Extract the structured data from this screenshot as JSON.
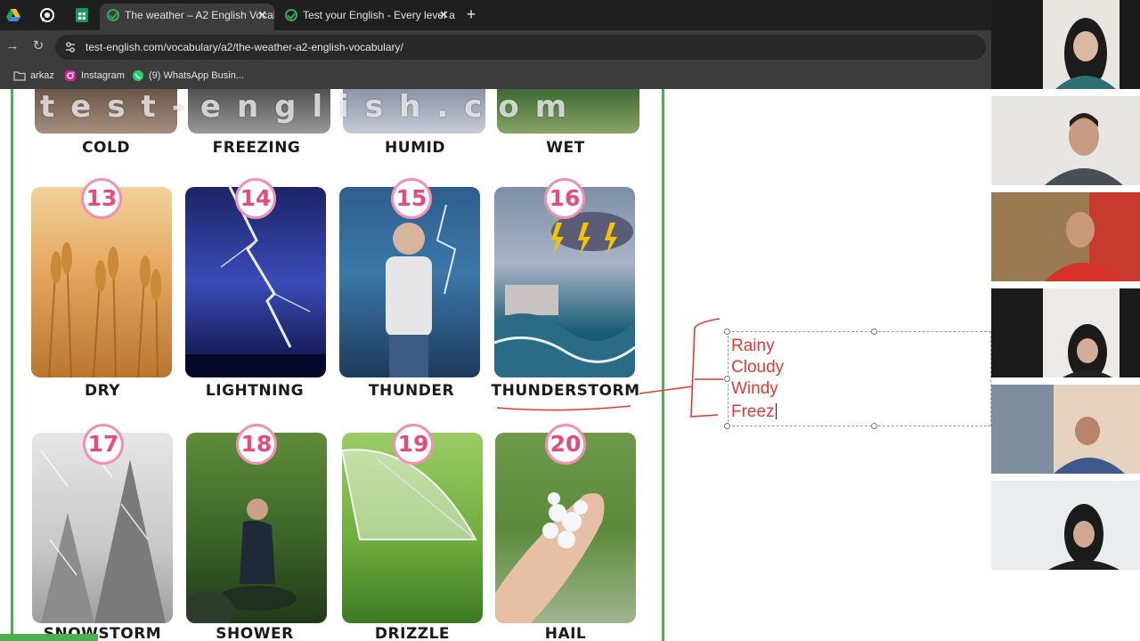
{
  "browser": {
    "tabs": [
      {
        "title": "The weather – A2 English Vocab",
        "active": true
      },
      {
        "title": "Test your English - Every level a",
        "active": false
      }
    ],
    "url": "test-english.com/vocabulary/a2/the-weather-a2-english-vocabulary/",
    "bookmarks": [
      "arkaz",
      "Instagram",
      "(9) WhatsApp Busin..."
    ]
  },
  "poster": {
    "watermark": "test-english.com",
    "top_row": [
      "COLD",
      "FREEZING",
      "HUMID",
      "WET"
    ],
    "cards": [
      {
        "number": "13",
        "label": "DRY"
      },
      {
        "number": "14",
        "label": "LIGHTNING"
      },
      {
        "number": "15",
        "label": "THUNDER"
      },
      {
        "number": "16",
        "label": "THUNDERSTORM"
      },
      {
        "number": "17",
        "label": "SNOWSTORM"
      },
      {
        "number": "18",
        "label": "SHOWER"
      },
      {
        "number": "19",
        "label": "DRIZZLE"
      },
      {
        "number": "20",
        "label": "HAIL"
      }
    ]
  },
  "annotation": {
    "lines": [
      "Rainy",
      "Cloudy",
      "Windy",
      "Freez"
    ],
    "color": "#e53935"
  },
  "icons": {
    "drive": "google-drive-icon",
    "whatsapp": "whatsapp-icon",
    "sheets": "google-sheets-icon",
    "back": "back-arrow-icon",
    "reload": "reload-icon",
    "site_info": "site-info-icon",
    "folder": "folder-icon"
  }
}
